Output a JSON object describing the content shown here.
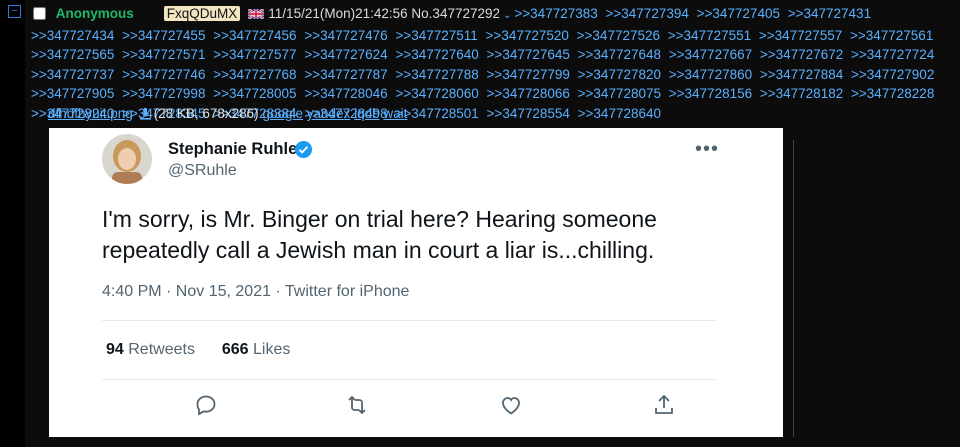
{
  "post": {
    "name": "Anonymous",
    "poster_id": "FxqQDuMX",
    "flag": "uk-flag",
    "datetime": "11/15/21(Mon)21:42:56",
    "post_no": "No.347727292",
    "replies": [
      ">>347727383",
      ">>347727394",
      ">>347727405",
      ">>347727431",
      ">>347727434",
      ">>347727455",
      ">>347727456",
      ">>347727476",
      ">>347727511",
      ">>347727520",
      ">>347727526",
      ">>347727551",
      ">>347727557",
      ">>347727561",
      ">>347727565",
      ">>347727571",
      ">>347727577",
      ">>347727624",
      ">>347727640",
      ">>347727645",
      ">>347727648",
      ">>347727667",
      ">>347727672",
      ">>347727724",
      ">>347727737",
      ">>347727746",
      ">>347727768",
      ">>347727787",
      ">>347727788",
      ">>347727799",
      ">>347727820",
      ">>347727860",
      ">>347727884",
      ">>347727902",
      ">>347727905",
      ">>347727998",
      ">>347728005",
      ">>347728046",
      ">>347728060",
      ">>347728066",
      ">>347728075",
      ">>347728156",
      ">>347728182",
      ">>347728228",
      ">>347728240",
      ">>347728345",
      ">>347728384",
      ">>347728498",
      ">>347728501",
      ">>347728554",
      ">>347728640"
    ]
  },
  "file": {
    "name": "dfhdfhyuit.png",
    "info": "(28 KB, 678x286)",
    "links": [
      "google",
      "yandex",
      "iqdb",
      "wait"
    ]
  },
  "tweet": {
    "display_name": "Stephanie Ruhle",
    "handle": "@SRuhle",
    "text": "I'm sorry, is Mr. Binger on trial here? Hearing someone repeatedly call a Jewish man in court a liar is...chilling.",
    "meta": "4:40 PM · Nov 15, 2021 · Twitter for iPhone",
    "retweets": "94",
    "retweets_label": "Retweets",
    "likes": "666",
    "likes_label": "Likes",
    "more_icon": "ellipsis-icon"
  },
  "colors": {
    "name": "#1fb86a",
    "link": "#5ab0ff",
    "tweet_text": "#0f1419",
    "tweet_muted": "#536471",
    "verified": "#1d9bf0"
  }
}
